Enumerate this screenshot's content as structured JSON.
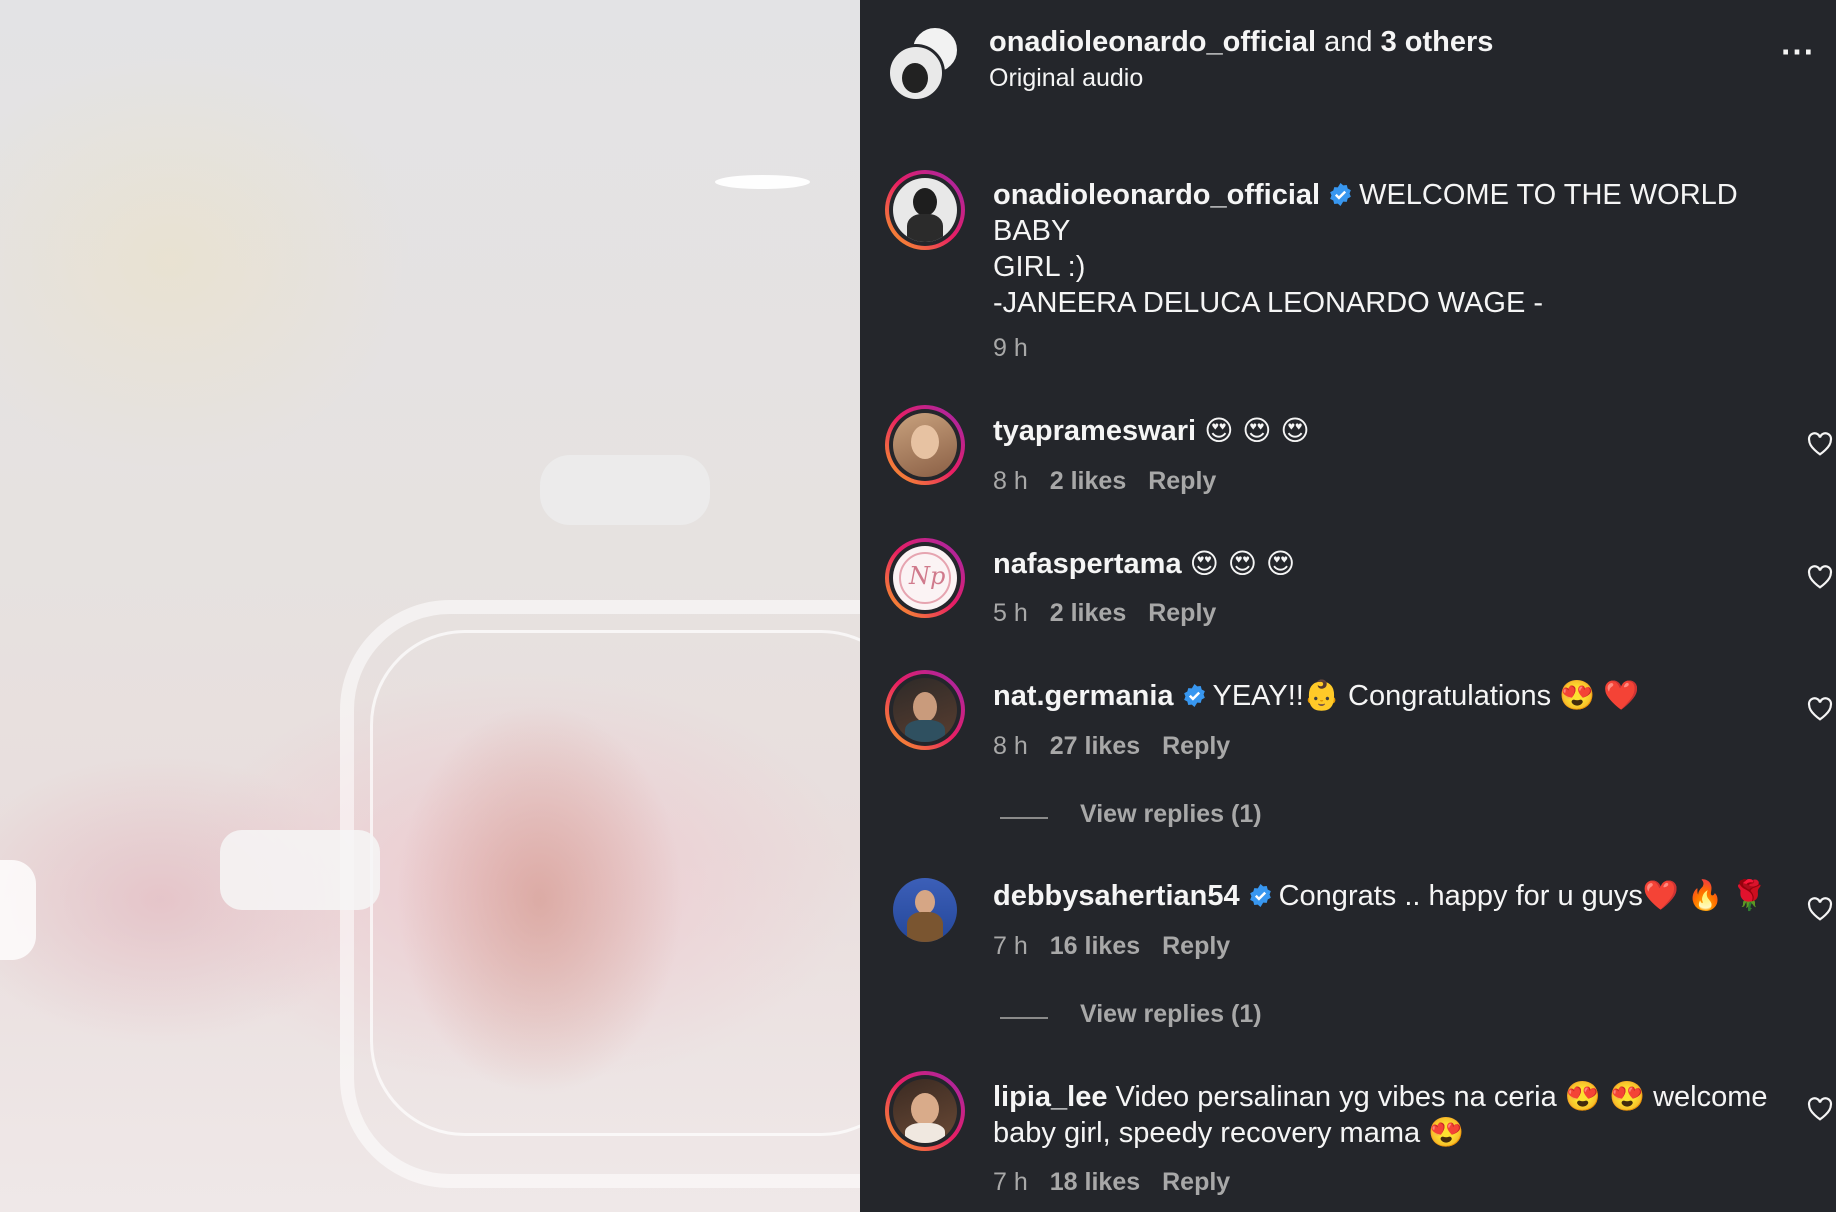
{
  "header": {
    "username": "onadioleonardo_official",
    "and_text": "and",
    "others": "3 others",
    "subtitle": "Original audio",
    "more_icon": "⋯"
  },
  "caption": {
    "username": "onadioleonardo_official",
    "text_line1": "WELCOME TO THE WORLD BABY",
    "text_line2": "GIRL :)",
    "text_line3": "-JANEERA DELUCA LEONARDO WAGE -",
    "time": "9 h"
  },
  "comments": [
    {
      "username": "tyaprameswari",
      "text": "😍 😍 😍",
      "time": "8 h",
      "likes": "2 likes",
      "reply": "Reply"
    },
    {
      "username": "nafaspertama",
      "text": "😍 😍 😍",
      "time": "5 h",
      "likes": "2 likes",
      "reply": "Reply"
    },
    {
      "username": "nat.germania",
      "text": "YEAY!!👶 Congratulations 😍 ❤️",
      "time": "8 h",
      "likes": "27 likes",
      "reply": "Reply",
      "view_replies": "View replies (1)"
    },
    {
      "username": "debbysahertian54",
      "text": "Congrats .. happy for u guys❤️ 🔥 🌹",
      "time": "7 h",
      "likes": "16 likes",
      "reply": "Reply",
      "view_replies": "View replies (1)"
    },
    {
      "username": "lipia_lee",
      "text_line1": "Video persalinan yg vibes na ceria 😍 😍  welcome",
      "text_line2": "baby girl, speedy recovery mama 😍",
      "time": "7 h",
      "likes": "18 likes",
      "reply": "Reply"
    }
  ],
  "colors": {
    "background": "#24262b",
    "verified": "#3897f0",
    "muted": "#a8a8a8"
  }
}
